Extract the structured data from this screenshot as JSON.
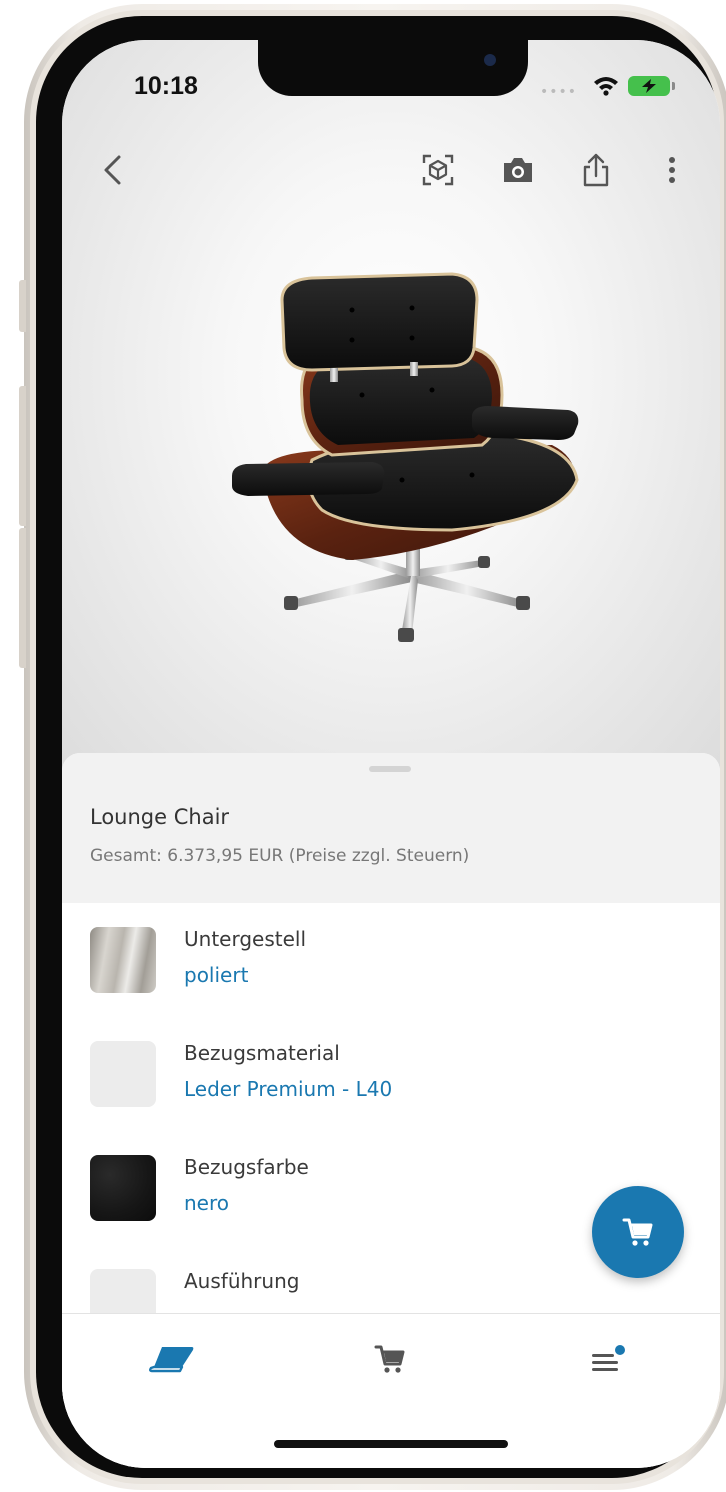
{
  "status_bar": {
    "time": "10:18"
  },
  "product": {
    "title": "Lounge Chair",
    "total": "Gesamt: 6.373,95 EUR (Preise zzgl. Steuern)"
  },
  "options": [
    {
      "label": "Untergestell",
      "value": "poliert",
      "swatch": "polished-metal"
    },
    {
      "label": "Bezugsmaterial",
      "value": "Leder Premium - L40",
      "swatch": "empty"
    },
    {
      "label": "Bezugsfarbe",
      "value": "nero",
      "swatch": "black-leather"
    },
    {
      "label": "Ausführung",
      "value": "",
      "swatch": "empty"
    }
  ],
  "icons": {
    "back": "chevron-left-icon",
    "ar": "ar-cube-icon",
    "camera": "camera-icon",
    "share": "share-icon",
    "more": "more-vertical-icon",
    "fab": "cart-icon",
    "tabs": [
      "catalog-book-icon",
      "cart-icon",
      "menu-icon"
    ]
  },
  "colors": {
    "accent": "#1a78b0",
    "tab_inactive": "#555555"
  }
}
